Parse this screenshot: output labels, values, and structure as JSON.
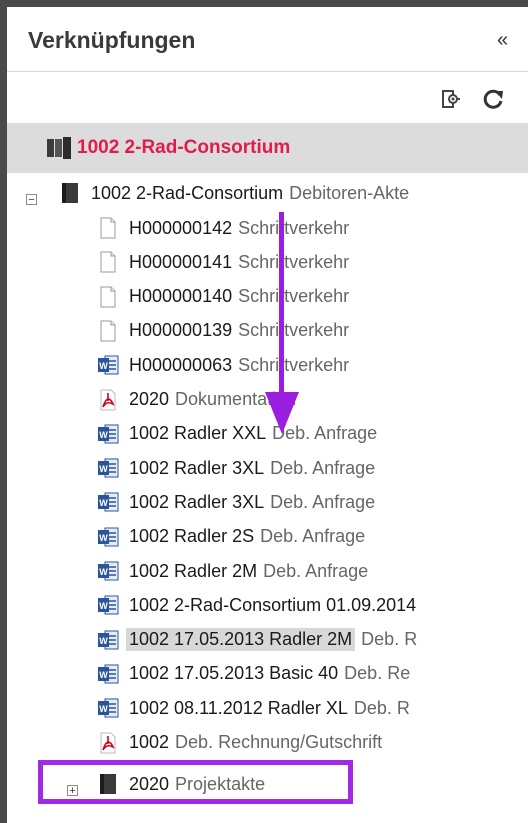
{
  "panel": {
    "title": "Verknüpfungen",
    "collapse_label": "«"
  },
  "root": {
    "label": "1002  2-Rad-Consortium"
  },
  "tree": {
    "parent": {
      "num": "1002  2-Rad-Consortium",
      "type": "Debitoren-Akte",
      "expander": "−"
    },
    "items": [
      {
        "icon": "document-icon",
        "num": "H000000142",
        "type": "Schriftverkehr"
      },
      {
        "icon": "document-icon",
        "num": "H000000141",
        "type": "Schriftverkehr"
      },
      {
        "icon": "document-icon",
        "num": "H000000140",
        "type": "Schriftverkehr"
      },
      {
        "icon": "document-icon",
        "num": "H000000139",
        "type": "Schriftverkehr"
      },
      {
        "icon": "word-icon",
        "num": "H000000063",
        "type": "Schriftverkehr"
      },
      {
        "icon": "pdf-icon",
        "num": "2020",
        "type": "Dokumentation"
      },
      {
        "icon": "word-icon",
        "num": "1002  Radler XXL",
        "type": "Deb. Anfrage"
      },
      {
        "icon": "word-icon",
        "num": "1002  Radler 3XL",
        "type": "Deb. Anfrage"
      },
      {
        "icon": "word-icon",
        "num": "1002  Radler 3XL",
        "type": "Deb. Anfrage"
      },
      {
        "icon": "word-icon",
        "num": "1002  Radler 2S",
        "type": "Deb. Anfrage"
      },
      {
        "icon": "word-icon",
        "num": "1002  Radler 2M",
        "type": "Deb. Anfrage"
      },
      {
        "icon": "word-icon",
        "num": "1002  2-Rad-Consortium  01.09.2014",
        "type": ""
      },
      {
        "icon": "word-icon",
        "num": "1002    17.05.2013  Radler 2M",
        "type": "Deb. R"
      },
      {
        "icon": "word-icon",
        "num": "1002    17.05.2013    Basic 40",
        "type": "Deb. Re"
      },
      {
        "icon": "word-icon",
        "num": "1002    08.11.2012  Radler XL",
        "type": "Deb. R"
      },
      {
        "icon": "pdf-icon",
        "num": "1002",
        "type": "Deb. Rechnung/Gutschrift"
      }
    ],
    "sibling": {
      "num": "2020",
      "type": "Projektakte",
      "expander": "+"
    }
  },
  "colors": {
    "accent": "#e01c4c",
    "annotation": "#9b1de0",
    "selected_bg": "#d8d8d8"
  }
}
